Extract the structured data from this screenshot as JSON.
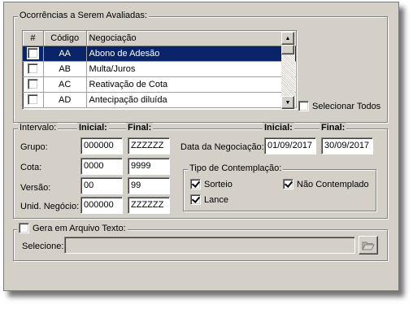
{
  "ocorrencias": {
    "legend": "Ocorrências a Serem Avaliadas:",
    "columns": [
      "#",
      "Código",
      "Negociação"
    ],
    "rows": [
      {
        "codigo": "AA",
        "negociacao": "Abono de Adesão",
        "selected": true
      },
      {
        "codigo": "AB",
        "negociacao": "Multa/Juros",
        "selected": false
      },
      {
        "codigo": "AC",
        "negociacao": "Reativação de Cota",
        "selected": false
      },
      {
        "codigo": "AD",
        "negociacao": "Antecipação diluída",
        "selected": false
      }
    ],
    "select_all_label": "Selecionar Todos"
  },
  "intervalo": {
    "legend": "Intervalo:",
    "inicial_header": "Inicial:",
    "final_header": "Final:",
    "rows": [
      {
        "label": "Grupo:",
        "inicial": "000000",
        "final": "ZZZZZZ"
      },
      {
        "label": "Cota:",
        "inicial": "0000",
        "final": "9999"
      },
      {
        "label": "Versão:",
        "inicial": "00",
        "final": "99"
      },
      {
        "label": "Unid. Negócio:",
        "inicial": "000000",
        "final": "ZZZZZZ"
      }
    ],
    "data_negociacao": {
      "label": "Data da Negociação:",
      "inicial_header": "Inicial:",
      "final_header": "Final:",
      "inicial": "01/09/2017",
      "final": "30/09/2017"
    },
    "contemplacao": {
      "legend": "Tipo de Contemplação:",
      "sorteio": "Sorteio",
      "lance": "Lance",
      "nao_contemplado": "Não Contemplado"
    }
  },
  "arquivo": {
    "legend": "Gera em Arquivo Texto:",
    "selecione_label": "Selecione:",
    "path_value": ""
  }
}
